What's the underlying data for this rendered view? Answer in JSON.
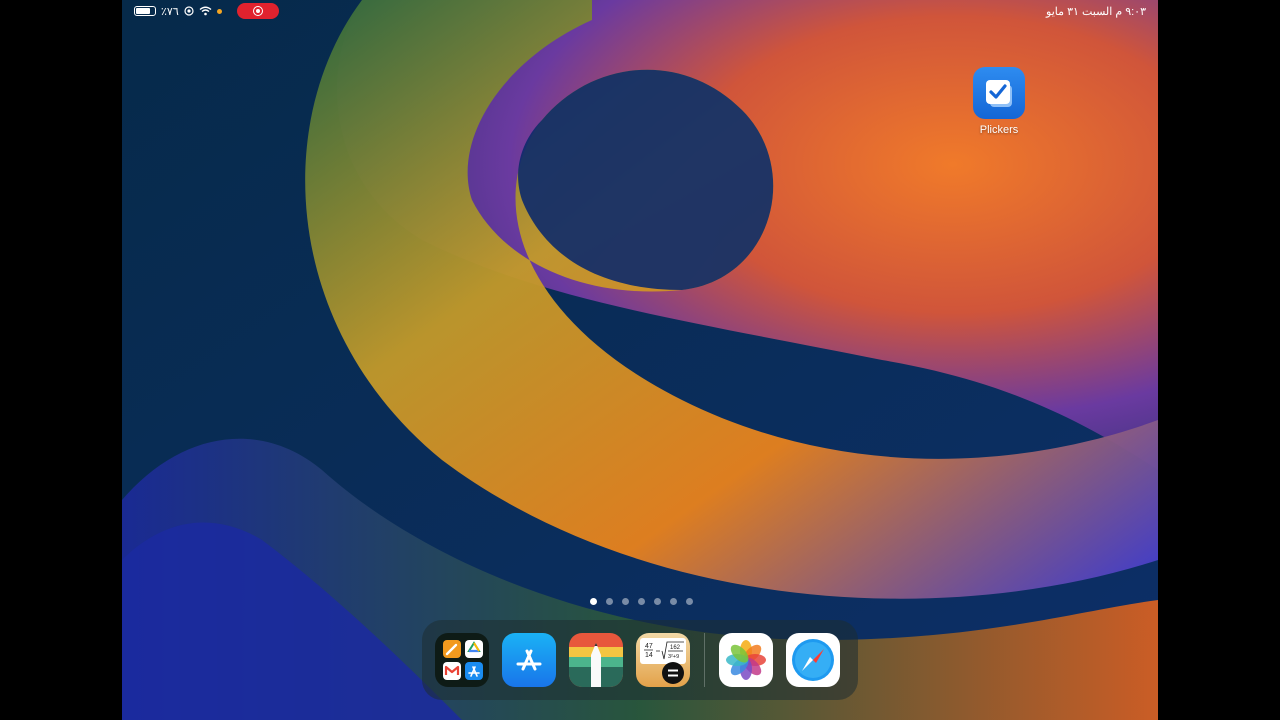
{
  "status_bar": {
    "battery_text": "٪٧٦",
    "battery_level": 0.76,
    "date_time": "٩:٠٣ م  السبت ٣١ مايو",
    "recording": true
  },
  "home_screen": {
    "apps": [
      {
        "label": "Plickers",
        "icon": "plickers-checkmark-icon"
      }
    ],
    "page_count": 7,
    "active_page": 1
  },
  "dock": {
    "apps": [
      {
        "name": "folder",
        "icon": "app-folder-icon"
      },
      {
        "name": "App Store",
        "icon": "app-store-icon"
      },
      {
        "name": "Notes",
        "icon": "notes-pencil-icon"
      },
      {
        "name": "Calculator",
        "icon": "math-calculator-icon"
      },
      {
        "name": "Photos",
        "icon": "photos-flower-icon"
      },
      {
        "name": "Safari",
        "icon": "safari-compass-icon"
      }
    ],
    "calc_icon_text": {
      "top": "47",
      "bottom": "14",
      "root": "162",
      "root_bottom": "3²+9"
    }
  },
  "colors": {
    "record": "#e0222e",
    "accent_blue": "#1466d6"
  }
}
